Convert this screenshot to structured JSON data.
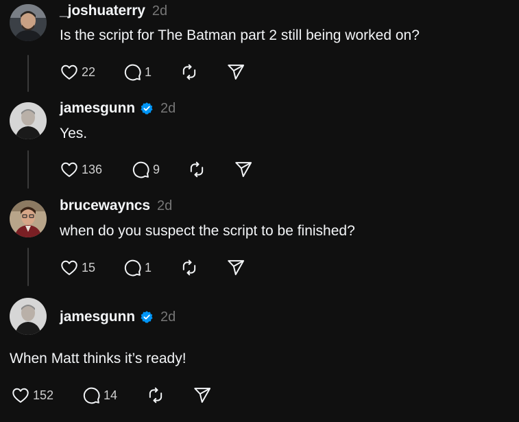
{
  "posts": [
    {
      "username": "_joshuaterry",
      "verified": false,
      "timestamp": "2d",
      "text": "Is the script for The Batman part 2 still being worked on?",
      "likes": "22",
      "replies": "1"
    },
    {
      "username": "jamesgunn",
      "verified": true,
      "timestamp": "2d",
      "text": "Yes.",
      "likes": "136",
      "replies": "9"
    },
    {
      "username": "brucewayncs",
      "verified": false,
      "timestamp": "2d",
      "text": "when do you suspect the script to be finished?",
      "likes": "15",
      "replies": "1"
    },
    {
      "username": "jamesgunn",
      "verified": true,
      "timestamp": "2d",
      "text": "When Matt thinks it’s ready!",
      "likes": "152",
      "replies": "14"
    }
  ],
  "icons": {
    "like": "heart-icon",
    "reply": "comment-icon",
    "repost": "repost-icon",
    "share": "send-icon",
    "verified": "verified-badge-icon"
  },
  "colors": {
    "background": "#101010",
    "text": "#f3f5f7",
    "muted": "#777777",
    "verified": "#0095f6",
    "thread_line": "#3a3a3a"
  }
}
